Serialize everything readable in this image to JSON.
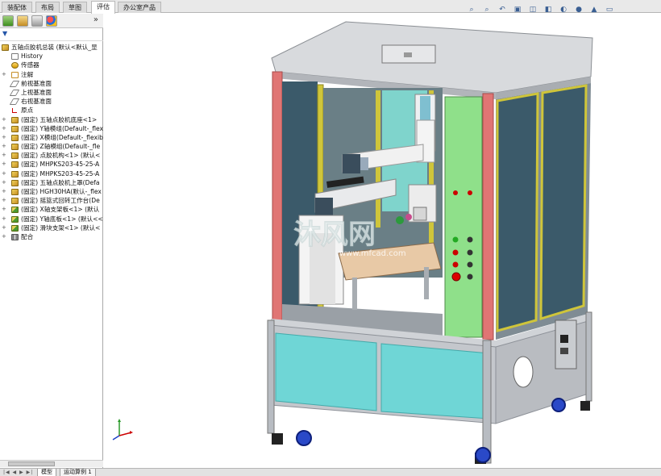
{
  "cmd_tabs": [
    "装配体",
    "布局",
    "草图",
    "评估",
    "办公室产品"
  ],
  "active_cmd_tab": "评估",
  "panel": {
    "more_glyph": "»",
    "filter_glyph": "▼",
    "tree": [
      {
        "label": "五轴点胶机总装  (默认<默认_显",
        "icon": "asm",
        "indent": 0,
        "expander": ""
      },
      {
        "label": "History",
        "icon": "hist",
        "indent": 1,
        "expander": ""
      },
      {
        "label": "传感器",
        "icon": "sens",
        "indent": 1,
        "expander": ""
      },
      {
        "label": "注解",
        "icon": "anno",
        "indent": 1,
        "expander": "+"
      },
      {
        "label": "前视基准面",
        "icon": "plane",
        "indent": 1,
        "expander": ""
      },
      {
        "label": "上视基准面",
        "icon": "plane",
        "indent": 1,
        "expander": ""
      },
      {
        "label": "右视基准面",
        "icon": "plane",
        "indent": 1,
        "expander": ""
      },
      {
        "label": "原点",
        "icon": "orig",
        "indent": 1,
        "expander": ""
      },
      {
        "label": "(固定) 五轴点胶机底座<1>",
        "icon": "asm",
        "indent": 1,
        "expander": "+"
      },
      {
        "label": "(固定) Y轴模组(Default-_flex",
        "icon": "asm",
        "indent": 1,
        "expander": "+"
      },
      {
        "label": "(固定) X模组(Default-_flexib",
        "icon": "asm",
        "indent": 1,
        "expander": "+"
      },
      {
        "label": "(固定) Z轴模组(Default-_fle",
        "icon": "asm",
        "indent": 1,
        "expander": "+"
      },
      {
        "label": "(固定) 点胶机构<1> (默认<",
        "icon": "asm",
        "indent": 1,
        "expander": "+"
      },
      {
        "label": "(固定) MHPKS203-45-25-A",
        "icon": "asm",
        "indent": 1,
        "expander": "+"
      },
      {
        "label": "(固定) MHPKS203-45-25-A",
        "icon": "asm",
        "indent": 1,
        "expander": "+"
      },
      {
        "label": "(固定) 五轴点胶机上罩(Defa",
        "icon": "asm",
        "indent": 1,
        "expander": "+"
      },
      {
        "label": "(固定) HGH30HA(默认-_flex",
        "icon": "asm",
        "indent": 1,
        "expander": "+"
      },
      {
        "label": "(固定) 摇篮式回转工作台(De",
        "icon": "asm",
        "indent": 1,
        "expander": "+"
      },
      {
        "label": "(固定) X轴支架板<1> (默认",
        "icon": "part",
        "indent": 1,
        "expander": "+"
      },
      {
        "label": "(固定) Y轴底板<1> (默认<<",
        "icon": "part",
        "indent": 1,
        "expander": "+"
      },
      {
        "label": "(固定) 滑块支架<1> (默认<",
        "icon": "part",
        "indent": 1,
        "expander": "+"
      },
      {
        "label": "配合",
        "icon": "mate",
        "indent": 1,
        "expander": "+"
      }
    ]
  },
  "bottom": {
    "nav": "|◀ ◀ ▶ ▶|",
    "tabs": [
      "模型",
      "运动算例 1"
    ]
  },
  "hud_icons": [
    "zoom-to-fit-icon",
    "zoom-area-icon",
    "previous-view-icon",
    "section-view-icon",
    "view-orientation-icon",
    "display-style-icon",
    "hide-show-icon",
    "edit-appearance-icon",
    "apply-scene-icon",
    "view-settings-icon"
  ],
  "hud_glyphs": [
    "⌕",
    "⌕",
    "↶",
    "▣",
    "◫",
    "◧",
    "◐",
    "●",
    "▲",
    "▭"
  ],
  "watermark": {
    "main": "沐风网",
    "sub": "www.mfcad.com"
  },
  "colors": {
    "frame": "#b8bcc2",
    "frame_dark": "#8d9198",
    "top": "#d7d9dc",
    "glass": "#3b5a6a",
    "yellow": "#cfc53a",
    "pink": "#e0706f",
    "green_panel": "#8fe08a",
    "cyan_door": "#6fd6d6",
    "base": "#c4c7cc",
    "wheel": "#2a49c8"
  }
}
